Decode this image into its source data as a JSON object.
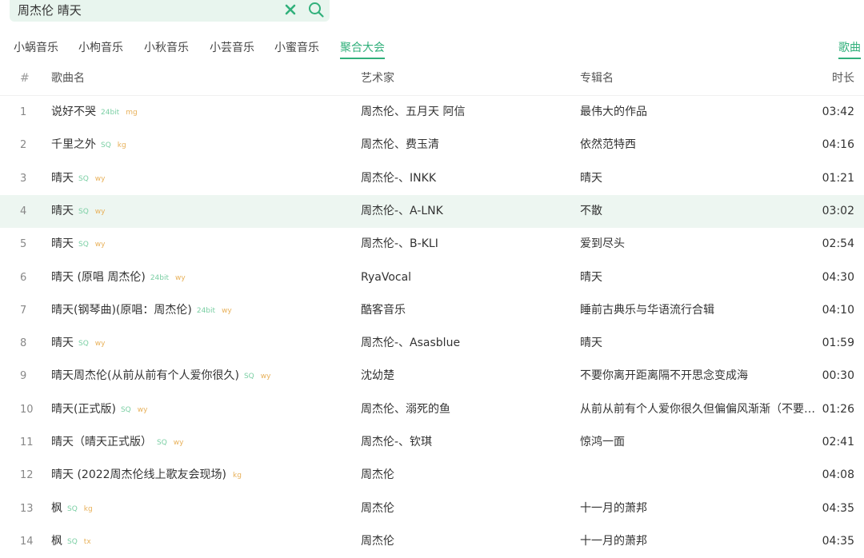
{
  "search": {
    "query": "周杰伦 晴天",
    "clear_icon": "close-icon",
    "search_icon": "search-icon"
  },
  "tabs": [
    {
      "label": "小蜗音乐",
      "active": false
    },
    {
      "label": "小枸音乐",
      "active": false
    },
    {
      "label": "小秋音乐",
      "active": false
    },
    {
      "label": "小芸音乐",
      "active": false
    },
    {
      "label": "小蜜音乐",
      "active": false
    },
    {
      "label": "聚合大会",
      "active": true
    }
  ],
  "type_tab": {
    "label": "歌曲",
    "active": true
  },
  "colors": {
    "accent": "#31b07b",
    "search_bg": "#e8f5ee",
    "selected_row_bg": "#edf6f1",
    "quality_tag": "#7bcfa4",
    "source_tag": "#e8b15a"
  },
  "table": {
    "headers": {
      "index": "#",
      "title": "歌曲名",
      "artist": "艺术家",
      "album": "专辑名",
      "duration": "时长"
    },
    "rows": [
      {
        "index": "1",
        "title": "说好不哭",
        "quality": "24bit",
        "source": "mg",
        "artist": "周杰伦、五月天 阿信",
        "album": "最伟大的作品",
        "duration": "03:42"
      },
      {
        "index": "2",
        "title": "千里之外",
        "quality": "SQ",
        "source": "kg",
        "artist": "周杰伦、费玉清",
        "album": "依然范特西",
        "duration": "04:16"
      },
      {
        "index": "3",
        "title": "晴天",
        "quality": "SQ",
        "source": "wy",
        "artist": "周杰伦-、INKK",
        "album": "晴天",
        "duration": "01:21"
      },
      {
        "index": "4",
        "title": "晴天",
        "quality": "SQ",
        "source": "wy",
        "artist": "周杰伦-、A-LNK",
        "album": "不散",
        "duration": "03:02"
      },
      {
        "index": "5",
        "title": "晴天",
        "quality": "SQ",
        "source": "wy",
        "artist": "周杰伦-、B-KLI",
        "album": "爱到尽头",
        "duration": "02:54"
      },
      {
        "index": "6",
        "title": "晴天 (原唱 周杰伦)",
        "quality": "24bit",
        "source": "wy",
        "artist": "RyaVocal",
        "album": "晴天",
        "duration": "04:30"
      },
      {
        "index": "7",
        "title": "晴天(钢琴曲)(原唱：周杰伦)",
        "quality": "24bit",
        "source": "wy",
        "artist": "酷客音乐",
        "album": "睡前古典乐与华语流行合辑",
        "duration": "04:10"
      },
      {
        "index": "8",
        "title": "晴天",
        "quality": "SQ",
        "source": "wy",
        "artist": "周杰伦-、Asasblue",
        "album": "晴天",
        "duration": "01:59"
      },
      {
        "index": "9",
        "title": "晴天周杰伦(从前从前有个人爱你很久)",
        "quality": "SQ",
        "source": "wy",
        "artist": "沈幼楚",
        "album": "不要你离开距离隔不开思念变成海",
        "duration": "00:30"
      },
      {
        "index": "10",
        "title": "晴天(正式版)",
        "quality": "SQ",
        "source": "wy",
        "artist": "周杰伦、溺死的鱼",
        "album": "从前从前有个人爱你很久但偏偏风渐渐（不要你...",
        "duration": "01:26"
      },
      {
        "index": "11",
        "title": "晴天（晴天正式版）",
        "quality": "SQ",
        "source": "wy",
        "artist": "周杰伦-、钦琪",
        "album": "惊鸿一面",
        "duration": "02:41"
      },
      {
        "index": "12",
        "title": "晴天 (2022周杰伦线上歌友会现场)",
        "quality": "",
        "source": "kg",
        "artist": "周杰伦",
        "album": "",
        "duration": "04:08"
      },
      {
        "index": "13",
        "title": "枫",
        "quality": "SQ",
        "source": "kg",
        "artist": "周杰伦",
        "album": "十一月的萧邦",
        "duration": "04:35"
      },
      {
        "index": "14",
        "title": "枫",
        "quality": "SQ",
        "source": "tx",
        "artist": "周杰伦",
        "album": "十一月的萧邦",
        "duration": "04:35"
      }
    ],
    "selected_index": "4"
  }
}
